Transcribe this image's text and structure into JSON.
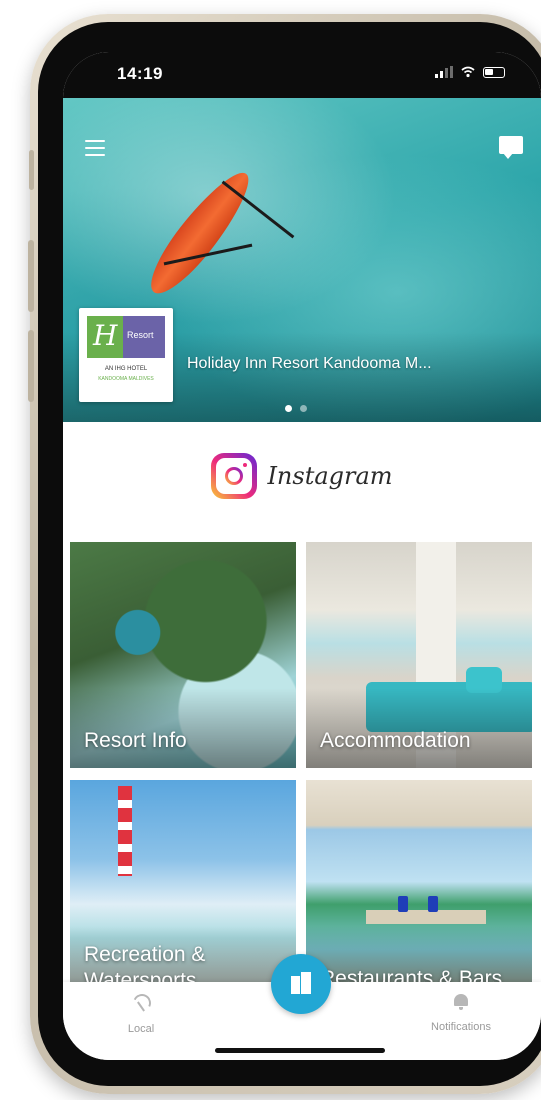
{
  "status_bar": {
    "time": "14:19"
  },
  "hero": {
    "caption": "Holiday Inn Resort Kandooma M...",
    "logo": {
      "brand_top": "Holiday Inn",
      "brand_resort": "Resort",
      "ihg_line": "AN IHG HOTEL",
      "location": "KANDOOMA MALDIVES"
    },
    "slides": 2,
    "active_slide": 1
  },
  "instagram": {
    "label": "Instagram"
  },
  "tiles": [
    {
      "label": "Resort Info"
    },
    {
      "label": "Accommodation"
    },
    {
      "label": "Recreation & Watersports"
    },
    {
      "label": "Restaurants & Bars"
    }
  ],
  "bottom_nav": {
    "left_label": "Local",
    "right_label": "Notifications",
    "accent_color": "#22a7d4"
  }
}
